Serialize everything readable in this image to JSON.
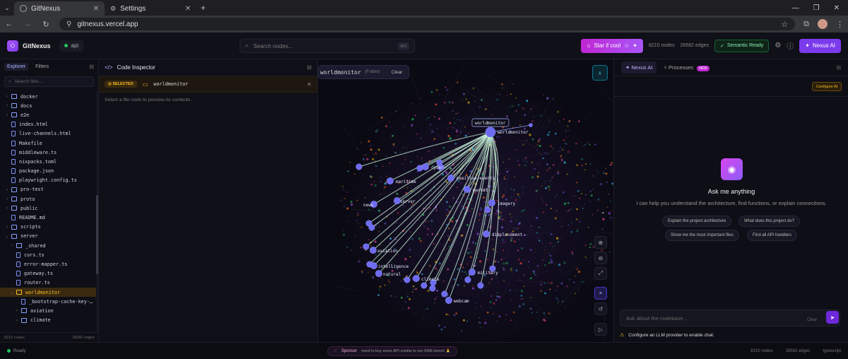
{
  "browser": {
    "tabs": [
      {
        "title": "GitNexus",
        "active": true
      },
      {
        "title": "Settings",
        "active": false
      }
    ],
    "url": "gitnexus.vercel.app"
  },
  "header": {
    "brand": "GitNexus",
    "repo": "api",
    "search_placeholder": "Search nodes...",
    "search_shortcut": "⌘K",
    "star_label": "Star if cool",
    "nodes": "8210 nodes",
    "edges": "26582 edges",
    "semantic": "Semantic Ready",
    "nexus_ai": "Nexus AI"
  },
  "explorer": {
    "tab_explorer": "Explorer",
    "tab_filters": "Filters",
    "search_placeholder": "Search files...",
    "footer_nodes": "8210 nodes",
    "footer_edges": "26582 edges",
    "items": [
      {
        "label": "docker",
        "type": "folder",
        "depth": 0,
        "open": false
      },
      {
        "label": "docs",
        "type": "folder",
        "depth": 0,
        "open": false
      },
      {
        "label": "e2e",
        "type": "folder",
        "depth": 0,
        "open": false
      },
      {
        "label": "index.html",
        "type": "file",
        "depth": 0
      },
      {
        "label": "live-channels.html",
        "type": "file",
        "depth": 0
      },
      {
        "label": "Makefile",
        "type": "file",
        "depth": 0
      },
      {
        "label": "middleware.ts",
        "type": "file",
        "depth": 0
      },
      {
        "label": "nixpacks.toml",
        "type": "file",
        "depth": 0
      },
      {
        "label": "package.json",
        "type": "file",
        "depth": 0
      },
      {
        "label": "playwright.config.ts",
        "type": "file",
        "depth": 0
      },
      {
        "label": "pro-test",
        "type": "folder",
        "depth": 0,
        "open": false
      },
      {
        "label": "proto",
        "type": "folder",
        "depth": 0,
        "open": false
      },
      {
        "label": "public",
        "type": "folder",
        "depth": 0,
        "open": false
      },
      {
        "label": "README.md",
        "type": "file",
        "depth": 0
      },
      {
        "label": "scripts",
        "type": "folder",
        "depth": 0,
        "open": false
      },
      {
        "label": "server",
        "type": "folder",
        "depth": 0,
        "open": true
      },
      {
        "label": "_shared",
        "type": "folder",
        "depth": 1,
        "open": false
      },
      {
        "label": "cors.ts",
        "type": "file",
        "depth": 1
      },
      {
        "label": "error-mapper.ts",
        "type": "file",
        "depth": 1
      },
      {
        "label": "gateway.ts",
        "type": "file",
        "depth": 1
      },
      {
        "label": "router.ts",
        "type": "file",
        "depth": 1
      },
      {
        "label": "worldmonitor",
        "type": "folder",
        "depth": 1,
        "open": true,
        "selected": true
      },
      {
        "label": "_bootstrap-cache-key-…",
        "type": "file",
        "depth": 2
      },
      {
        "label": "aviation",
        "type": "folder",
        "depth": 2,
        "open": false
      },
      {
        "label": "climate",
        "type": "folder",
        "depth": 2,
        "open": false
      }
    ]
  },
  "inspector": {
    "title": "Code Inspector",
    "selected_badge": "SELECTED",
    "selected_name": "worldmonitor",
    "message": "Select a file node to preview its contents."
  },
  "graph": {
    "crumb_name": "worldmonitor",
    "crumb_kind": "(Folder)",
    "crumb_clear": "Clear",
    "tooltip": "worldmonitor",
    "center_label": "worldmonitor",
    "labels": [
      "cyber",
      "maritime",
      "positive-events",
      "market",
      "news",
      "server",
      "imagery",
      "displacement",
      "aviation",
      "intelligence",
      "natural",
      "climate",
      "military",
      "webcam"
    ]
  },
  "ai": {
    "tab_ai": "Nexus AI",
    "tab_processes": "Processes",
    "new_badge": "NEW",
    "configure": "Configure AI",
    "ask_title": "Ask me anything",
    "ask_sub": "I can help you understand the architecture, find functions, or explain connections.",
    "suggestions": [
      "Explain the project architecture",
      "What does this project do?",
      "Show me the most important files",
      "Find all API handlers"
    ],
    "input_placeholder": "Ask about the codebase...",
    "clear": "Clear",
    "warning": "Configure an LLM provider to enable chat."
  },
  "status": {
    "ready": "Ready",
    "sponsor": "Sponsor",
    "sponsor_text": "need to buy some API credits to run SWE-bench 🙏",
    "nodes": "8210 nodes",
    "edges": "26582 edges",
    "language": "typescript"
  }
}
